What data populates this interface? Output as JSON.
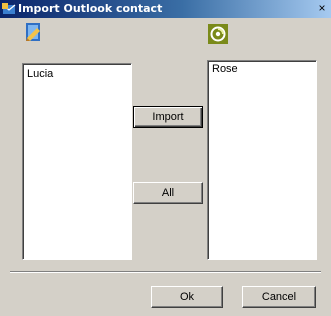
{
  "window": {
    "title": "Import Outlook contact",
    "close_glyph": "×"
  },
  "icons": {
    "title": "outlook-icon",
    "left_logo": "outlook-logo-icon",
    "right_logo": "app-logo-icon"
  },
  "left_list": {
    "items": [
      "Lucia"
    ]
  },
  "right_list": {
    "items": [
      "Rose"
    ]
  },
  "buttons": {
    "import": "Import",
    "all": "All",
    "ok": "Ok",
    "cancel": "Cancel"
  },
  "colors": {
    "titlebar_start": "#0a246a",
    "titlebar_end": "#a6caf0",
    "face": "#d4d0c8",
    "right_logo_bg": "#7a8a1a"
  }
}
